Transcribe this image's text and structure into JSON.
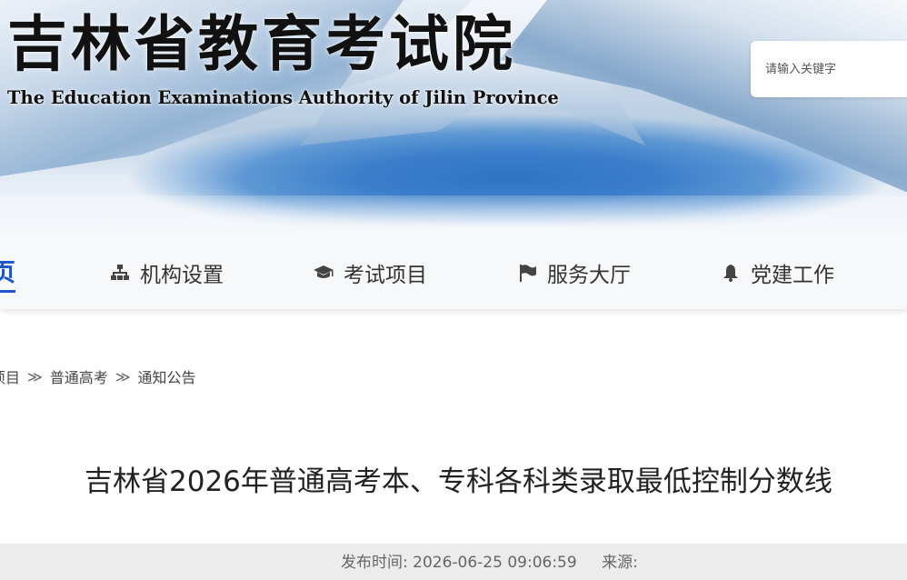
{
  "header": {
    "title": "吉林省教育考试院",
    "subtitle": "The Education Examinations Authority of Jilin Province",
    "search_placeholder": "请输入关键字"
  },
  "nav": {
    "home_partial": "页",
    "items": [
      {
        "label": "机构设置",
        "icon": "sitemap-icon"
      },
      {
        "label": "考试项目",
        "icon": "graduation-cap-icon"
      },
      {
        "label": "服务大厅",
        "icon": "flag-icon"
      },
      {
        "label": "党建工作",
        "icon": "bell-icon"
      }
    ]
  },
  "breadcrumb": {
    "items": [
      "项目",
      "普通高考",
      "通知公告"
    ],
    "separator": "≫"
  },
  "article": {
    "title": "吉林省2026年普通高考本、专科各科类录取最低控制分数线",
    "publish_label": "发布时间: 2026-06-25 09:06:59",
    "source_label": "来源:"
  },
  "colors": {
    "accent": "#1a57c8",
    "nav_bg": "#f7f8fa",
    "meta_bar": "#ececec"
  }
}
